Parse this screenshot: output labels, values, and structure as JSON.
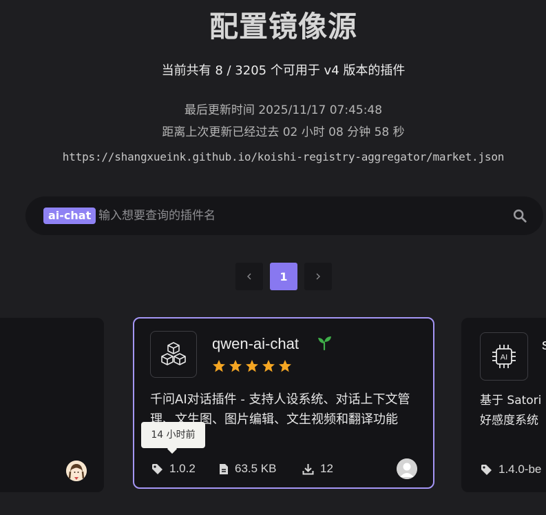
{
  "header": {
    "title": "配置镜像源",
    "summary": "当前共有 8 / 3205 个可用于 v4 版本的插件",
    "updated": "最后更新时间 2025/11/17 07:45:48",
    "elapsed": "距离上次更新已经过去 02 小时 08 分钟 58 秒",
    "registry_url": "https://shangxueink.github.io/koishi-registry-aggregator/market.json"
  },
  "search": {
    "active_tag": "ai-chat",
    "placeholder": "输入想要查询的插件名",
    "value": ""
  },
  "pagination": {
    "current_page": "1"
  },
  "cards": {
    "center": {
      "name": "qwen-ai-chat",
      "badge_icon": "sprout-icon",
      "rating": 5,
      "description": "千问AI对话插件 - 支持人设系统、对话上下文管理、文生图、图片编辑、文生视频和翻译功能",
      "version": "1.0.2",
      "size": "63.5 KB",
      "downloads": "12",
      "tooltip": "14 小时前"
    },
    "right": {
      "name_partial": "s",
      "description_partial": "基于 Satori 好感度系统",
      "version_partial": "1.4.0-be"
    }
  },
  "colors": {
    "accent": "#8f82f4",
    "star": "#f5a623",
    "sprout": "#3fae49"
  }
}
